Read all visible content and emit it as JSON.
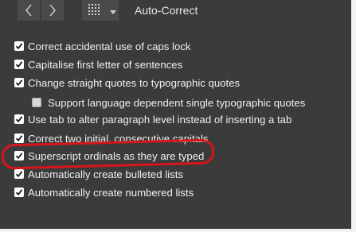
{
  "header": {
    "title": "Auto-Correct",
    "back_icon": "chevron-left-icon",
    "forward_icon": "chevron-right-icon",
    "grid_icon": "grid-icon",
    "menu_icon": "caret-down-icon"
  },
  "options": [
    {
      "label": "Correct accidental use of caps lock",
      "checked": true
    },
    {
      "label": "Capitalise first letter of sentences",
      "checked": true
    },
    {
      "label": "Change straight quotes to typographic quotes",
      "checked": true
    },
    {
      "label": "Support language dependent single typographic quotes",
      "checked": false,
      "indent": true
    },
    {
      "label": "Use tab to alter paragraph level instead of inserting a tab",
      "checked": true
    },
    {
      "label": "Correct two initial, consecutive capitals",
      "checked": true
    },
    {
      "label": "Superscript ordinals as they are typed",
      "checked": true,
      "highlighted": true
    },
    {
      "label": "Automatically create bulleted lists",
      "checked": true
    },
    {
      "label": "Automatically create numbered lists",
      "checked": true
    }
  ],
  "colors": {
    "panel_bg": "#3b3b3b",
    "highlight_ring": "#d8151d",
    "text": "#f0f0f0"
  }
}
